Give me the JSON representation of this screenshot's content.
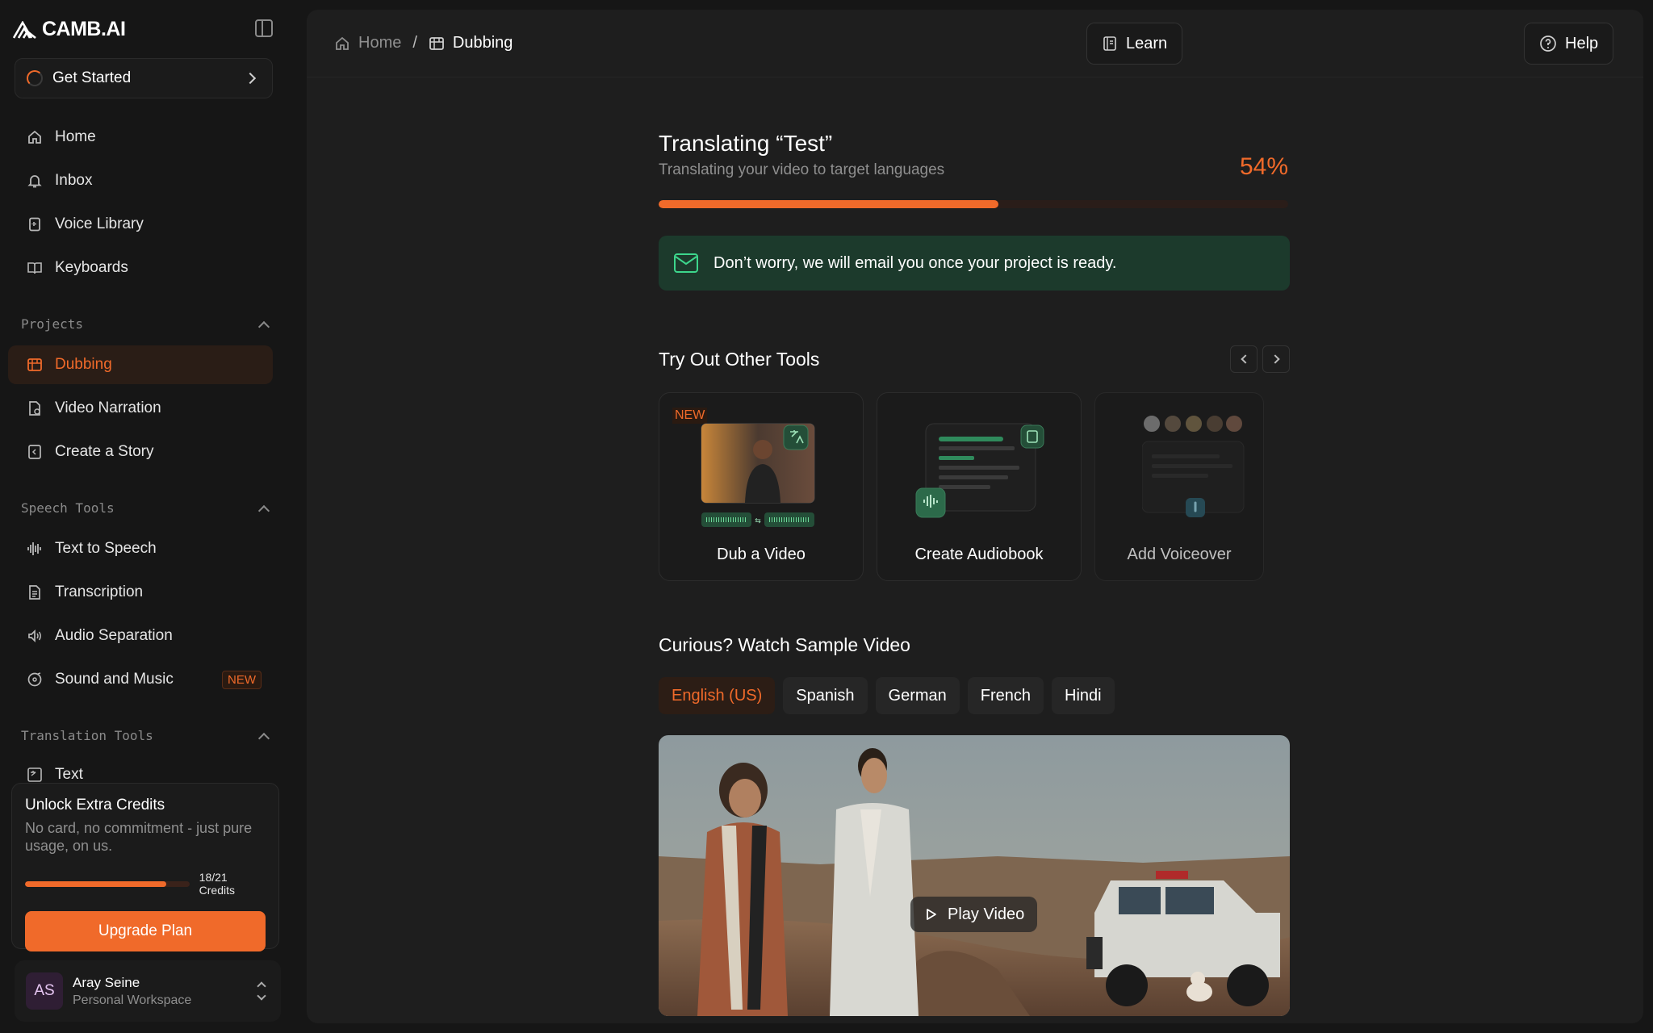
{
  "app": {
    "logo_text": "CAMB.AI"
  },
  "sidebar": {
    "get_started": "Get Started",
    "nav": [
      {
        "label": "Home",
        "icon": "home-icon"
      },
      {
        "label": "Inbox",
        "icon": "bell-icon"
      },
      {
        "label": "Voice Library",
        "icon": "voice-library-icon"
      },
      {
        "label": "Keyboards",
        "icon": "book-icon"
      }
    ],
    "sections": {
      "projects": {
        "title": "Projects",
        "items": [
          {
            "label": "Dubbing",
            "active": true
          },
          {
            "label": "Video Narration"
          },
          {
            "label": "Create a Story"
          }
        ]
      },
      "speech_tools": {
        "title": "Speech Tools",
        "items": [
          {
            "label": "Text to Speech"
          },
          {
            "label": "Transcription"
          },
          {
            "label": "Audio Separation"
          },
          {
            "label": "Sound and Music",
            "badge": "NEW"
          }
        ]
      },
      "translation_tools": {
        "title": "Translation Tools",
        "items": [
          {
            "label": "Text"
          }
        ]
      }
    },
    "credits": {
      "title": "Unlock Extra Credits",
      "subtitle": "No card, no commitment - just pure usage, on us.",
      "used": 18,
      "total": 21,
      "label": "18/21 Credits",
      "button": "Upgrade Plan"
    },
    "user": {
      "initials": "AS",
      "name": "Aray Seine",
      "workspace": "Personal Workspace"
    }
  },
  "header": {
    "breadcrumb": {
      "home": "Home",
      "separator": "/",
      "current": "Dubbing"
    },
    "learn": "Learn",
    "help": "Help"
  },
  "main": {
    "title": "Translating “Test”",
    "subtitle": "Translating your video to target languages",
    "progress_percent": 54,
    "progress_label": "54%",
    "email_notice": "Don’t worry, we will email you once your project is ready.",
    "tools_title": "Try Out Other Tools",
    "tools": [
      {
        "label": "Dub a Video",
        "badge": "NEW"
      },
      {
        "label": "Create Audiobook"
      },
      {
        "label": "Add Voiceover"
      }
    ],
    "sample_title": "Curious? Watch Sample Video",
    "languages": [
      {
        "label": "English (US)",
        "active": true
      },
      {
        "label": "Spanish"
      },
      {
        "label": "German"
      },
      {
        "label": "French"
      },
      {
        "label": "Hindi"
      }
    ],
    "play_label": "Play Video"
  },
  "colors": {
    "accent": "#f06a2a",
    "success_bg": "#1c3a2c",
    "background": "#161616",
    "panel": "#1e1e1e"
  }
}
